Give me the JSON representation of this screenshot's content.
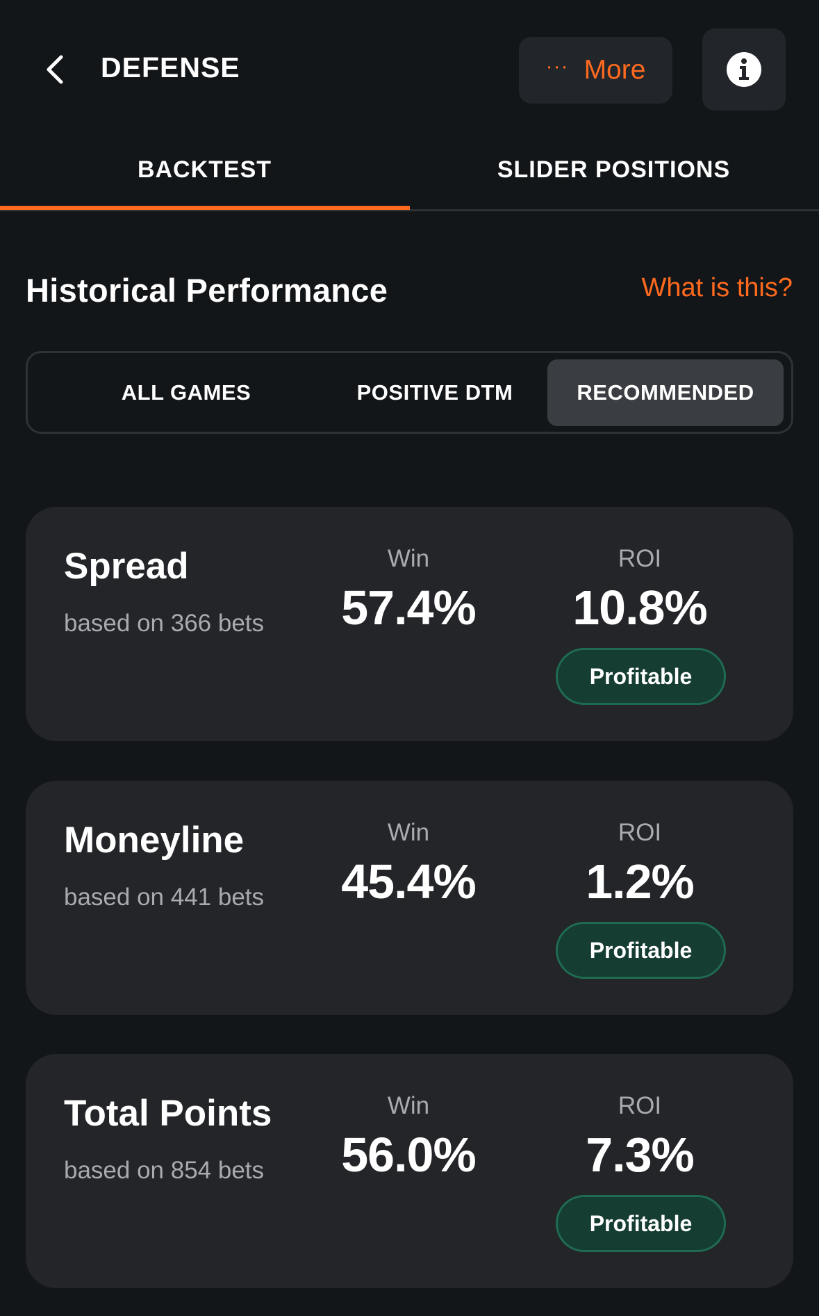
{
  "header": {
    "title": "DEFENSE",
    "more_label": "More",
    "more_dots": "···",
    "info_icon": "info-icon",
    "back_icon": "chevron-left-icon"
  },
  "tabs": [
    {
      "label": "BACKTEST",
      "active": true
    },
    {
      "label": "SLIDER POSITIONS",
      "active": false
    }
  ],
  "section": {
    "title": "Historical Performance",
    "help_link": "What is this?"
  },
  "filters": [
    {
      "label": "ALL GAMES",
      "selected": false
    },
    {
      "label": "POSITIVE DTM",
      "selected": false
    },
    {
      "label": "RECOMMENDED",
      "selected": true
    }
  ],
  "cards": [
    {
      "name": "Spread",
      "sub": "based on 366 bets",
      "win_label": "Win",
      "win": "57.4%",
      "roi_label": "ROI",
      "roi": "10.8%",
      "badge": "Profitable"
    },
    {
      "name": "Moneyline",
      "sub": "based on 441 bets",
      "win_label": "Win",
      "win": "45.4%",
      "roi_label": "ROI",
      "roi": "1.2%",
      "badge": "Profitable"
    },
    {
      "name": "Total Points",
      "sub": "based on 854 bets",
      "win_label": "Win",
      "win": "56.0%",
      "roi_label": "ROI",
      "roi": "7.3%",
      "badge": "Profitable"
    }
  ],
  "colors": {
    "background": "#131618",
    "accent": "#ff6a1f",
    "card": "#232528",
    "badge_bg": "#153d32",
    "badge_border": "#1f6b52"
  }
}
